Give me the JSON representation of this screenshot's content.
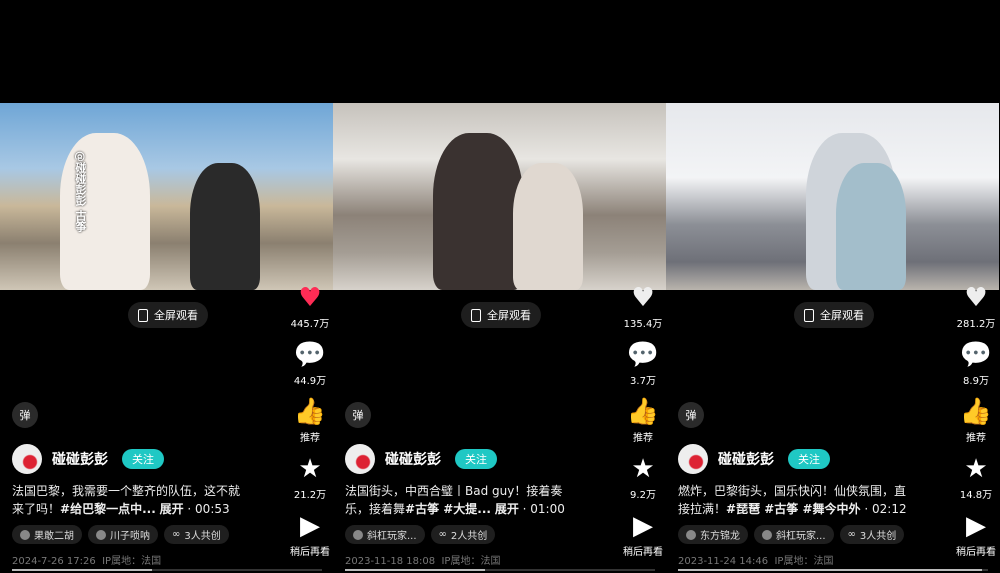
{
  "panels": [
    {
      "video_class": "v1",
      "watermark": "@碰碰彭彭 古筝",
      "fullscreen": "全屏观看",
      "like_count": "445.7万",
      "liked": true,
      "comment_count": "44.9万",
      "recommend": "推荐",
      "fav_count": "21.2万",
      "later": "稍后再看",
      "danmaku": "弹",
      "author": "碰碰彭彭",
      "follow": "关注",
      "desc": "法国巴黎，我需要一个整齐的队伍，这不就来了吗！",
      "hashtags": "#给巴黎一点中...",
      "expand": "展开",
      "duration": "· 00:53",
      "tags": [
        "果敢二胡",
        "川子唢呐",
        "3人共创"
      ],
      "date": "2024-7-26 17:26",
      "ip": "IP属地：法国",
      "progress": 0.45
    },
    {
      "video_class": "v2",
      "watermark": "",
      "fullscreen": "全屏观看",
      "like_count": "135.4万",
      "liked": false,
      "comment_count": "3.7万",
      "recommend": "推荐",
      "fav_count": "9.2万",
      "later": "稍后再看",
      "danmaku": "弹",
      "author": "碰碰彭彭",
      "follow": "关注",
      "desc": "法国街头，中西合璧丨Bad guy！接着奏乐，接着舞",
      "hashtags": "#古筝 #大提...",
      "expand": "展开",
      "duration": "· 01:00",
      "tags": [
        "斜杠玩家...",
        "2人共创"
      ],
      "date": "2023-11-18 18:08",
      "ip": "IP属地：法国",
      "progress": 0.45
    },
    {
      "video_class": "v3",
      "watermark": "",
      "fullscreen": "全屏观看",
      "like_count": "281.2万",
      "liked": false,
      "comment_count": "8.9万",
      "recommend": "推荐",
      "fav_count": "14.8万",
      "later": "稍后再看",
      "danmaku": "弹",
      "author": "碰碰彭彭",
      "follow": "关注",
      "desc": "燃炸，巴黎街头，国乐快闪！仙侠氛围，直接拉满！",
      "hashtags": "#琵琶 #古筝 #舞今中外",
      "expand": "",
      "duration": "· 02:12",
      "tags": [
        "东方锦龙",
        "斜杠玩家...",
        "3人共创"
      ],
      "date": "2023-11-24 14:46",
      "ip": "IP属地：法国",
      "progress": 0.98
    }
  ],
  "colors": {
    "like": "#fe2c55",
    "follow": "#1fc8c4"
  }
}
